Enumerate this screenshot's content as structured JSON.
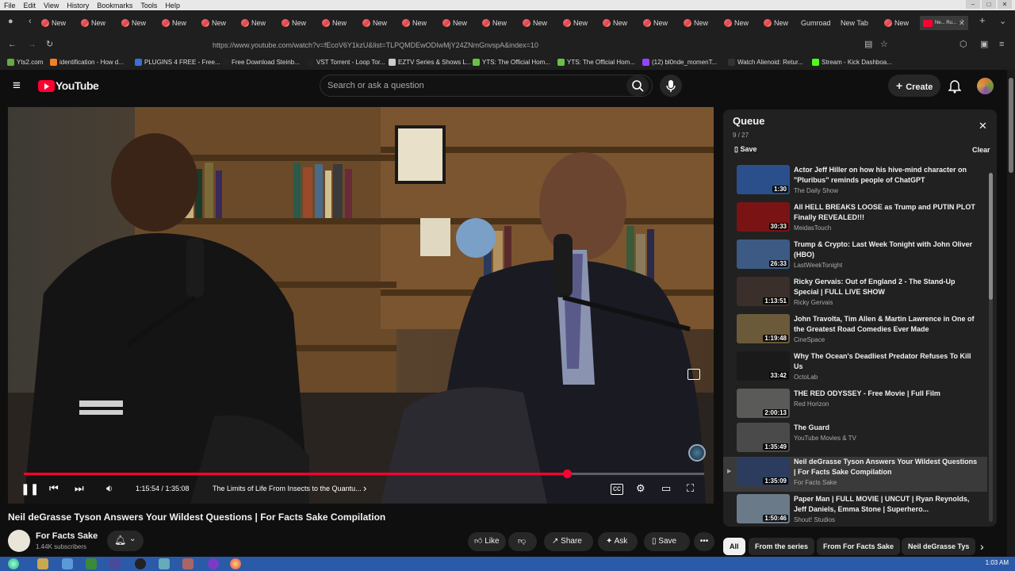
{
  "os_menubar": [
    "File",
    "Edit",
    "View",
    "History",
    "Bookmarks",
    "Tools",
    "Help"
  ],
  "tabs": [
    {
      "label": "New"
    },
    {
      "label": "New"
    },
    {
      "label": "New"
    },
    {
      "label": "New"
    },
    {
      "label": "New"
    },
    {
      "label": "New"
    },
    {
      "label": "New"
    },
    {
      "label": "New"
    },
    {
      "label": "New"
    },
    {
      "label": "New"
    },
    {
      "label": "New"
    },
    {
      "label": "New"
    },
    {
      "label": "New"
    },
    {
      "label": "New"
    },
    {
      "label": "New"
    },
    {
      "label": "New"
    },
    {
      "label": "New"
    },
    {
      "label": "New"
    },
    {
      "label": "New"
    },
    {
      "label": "Gumroad"
    },
    {
      "label": "New Tab"
    },
    {
      "label": "New"
    },
    {
      "label": "Ne... Ru..."
    }
  ],
  "browser": {
    "url": "https://www.youtube.com/watch?v=fEcoV6Y1kzU&list=TLPQMDEwODIwMjY24ZNmGnvspA&index=10"
  },
  "bookmarks": [
    {
      "label": "Yts2.com",
      "color": "#66aa44"
    },
    {
      "label": "identification - How d...",
      "color": "#f48024"
    },
    {
      "label": "PLUGINS 4 FREE - Free...",
      "color": "#3b6fd8"
    },
    {
      "label": "Free Download Steinb...",
      "color": "#222222"
    },
    {
      "label": "VST Torrent - Loop Tor...",
      "color": "#222222"
    },
    {
      "label": "EZTV Series & Shows L...",
      "color": "#cccccc"
    },
    {
      "label": "YTS: The Official Hom...",
      "color": "#6ac045"
    },
    {
      "label": "YTS: The Official Hom...",
      "color": "#6ac045"
    },
    {
      "label": "(12) bl0nde_momenT...",
      "color": "#9146ff"
    },
    {
      "label": "Watch Alienoid: Retur...",
      "color": "#333333"
    },
    {
      "label": "Stream - Kick Dashboa...",
      "color": "#53fc18"
    }
  ],
  "youtube": {
    "logo_text": "YouTube",
    "search_placeholder": "Search or ask a question",
    "create_label": "Create"
  },
  "player": {
    "time_current": "1:15:54",
    "time_total": "1:35:08",
    "time_display": "1:15:54 / 1:35:08",
    "chapter": "The Limits of Life From Insects to the Quantu...",
    "progress_fraction": 0.7978
  },
  "video": {
    "title": "Neil deGrasse Tyson Answers Your Wildest Questions | For Facts Sake Compilation",
    "channel": "For Facts Sake",
    "subscribers": "1.44K subscribers",
    "like_label": "Like",
    "share_label": "Share",
    "ask_label": "Ask",
    "save_label": "Save"
  },
  "queue": {
    "title": "Queue",
    "position": "9 / 27",
    "save_label": "Save",
    "clear_label": "Clear",
    "items": [
      {
        "title": "Actor Jeff Hiller on how his hive-mind character on \"Pluribus\" reminds people of ChatGPT",
        "channel": "The Daily Show",
        "duration": "1:30",
        "thumb": "#2a4f8a"
      },
      {
        "title": "All HELL BREAKS LOOSE as Trump and PUTIN PLOT Finally REVEALED!!!",
        "channel": "MeidasTouch",
        "duration": "30:33",
        "thumb": "#7a1414"
      },
      {
        "title": "Trump & Crypto: Last Week Tonight with John Oliver (HBO)",
        "channel": "LastWeekTonight",
        "duration": "26:33",
        "thumb": "#3c5a84"
      },
      {
        "title": "Ricky Gervais: Out of England 2 - The Stand-Up Special | FULL LIVE SHOW",
        "channel": "Ricky Gervais",
        "duration": "1:13:51",
        "thumb": "#3a2f2a"
      },
      {
        "title": "John Travolta, Tim Allen & Martin Lawrence in One of the Greatest Road Comedies Ever Made",
        "channel": "CineSpace",
        "duration": "1:19:48",
        "thumb": "#6b5a3a"
      },
      {
        "title": "Why The Ocean's Deadliest Predator Refuses To Kill Us",
        "channel": "OctoLab",
        "duration": "33:42",
        "thumb": "#1a1a1a"
      },
      {
        "title": "THE RED ODYSSEY - Free Movie | Full Film",
        "channel": "Red Horizon",
        "duration": "2:00:13",
        "thumb": "#5a5a58"
      },
      {
        "title": "The Guard",
        "channel": "YouTube Movies & TV",
        "duration": "1:35:49",
        "thumb": "#4a4a4a"
      },
      {
        "title": "Neil deGrasse Tyson Answers Your Wildest Questions | For Facts Sake Compilation",
        "channel": "For Facts Sake",
        "duration": "1:35:09",
        "thumb": "#2b3c5e",
        "active": true
      },
      {
        "title": "Paper Man | FULL MOVIE | UNCUT | Ryan Reynolds, Jeff Daniels, Emma Stone | Superhero...",
        "channel": "Shout! Studios",
        "duration": "1:50:46",
        "thumb": "#6b7a88"
      }
    ]
  },
  "chips": [
    "All",
    "From the series",
    "From For Facts Sake",
    "Neil deGrasse Tys"
  ],
  "taskbar": {
    "clock": "1:03 AM"
  }
}
